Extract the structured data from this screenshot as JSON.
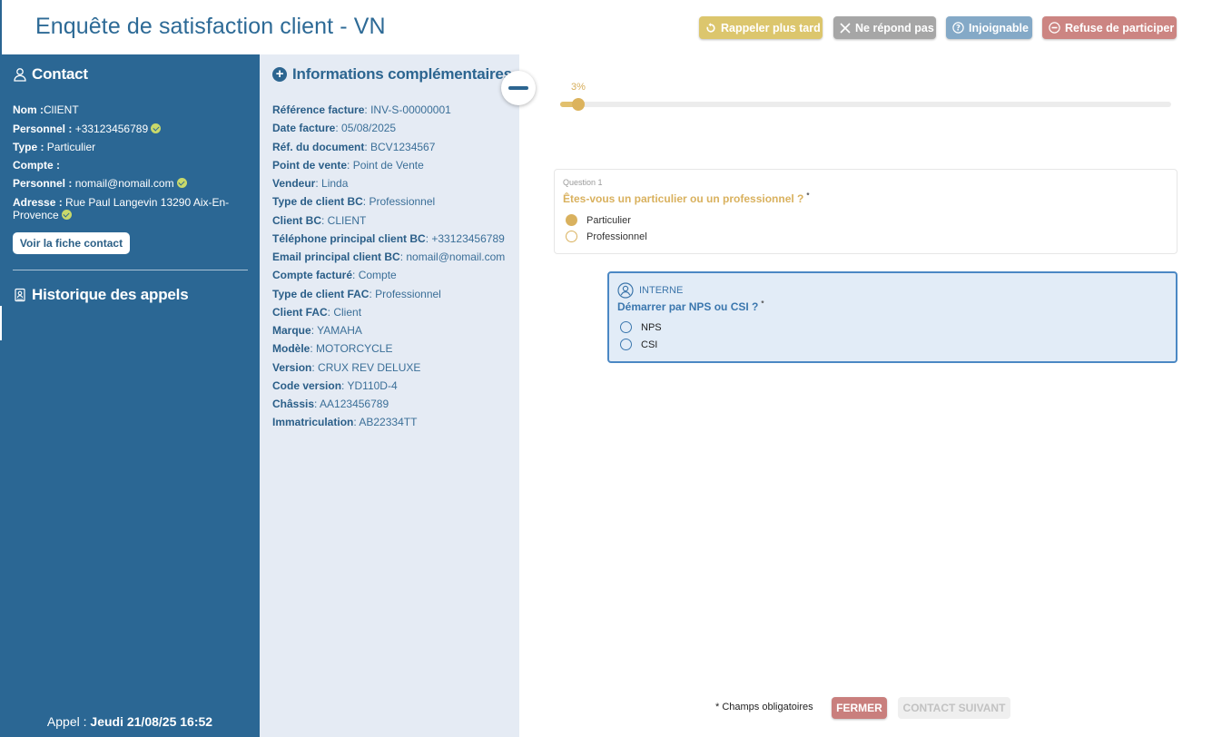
{
  "header": {
    "title": "Enquête de satisfaction client - VN",
    "buttons": [
      {
        "label": "Rappeler plus tard",
        "icon": "callback-icon",
        "color": "#dcc66d"
      },
      {
        "label": "Ne répond pas",
        "icon": "close-icon",
        "color": "#a6a6a6"
      },
      {
        "label": "Injoignable",
        "icon": "help-icon",
        "color": "#84a9c7"
      },
      {
        "label": "Refuse de participer",
        "icon": "minus-circle-icon",
        "color": "#cc8582"
      }
    ]
  },
  "contact": {
    "title": "Contact",
    "lines": [
      {
        "label": "Nom :",
        "value": "ClIENT"
      },
      {
        "label": "Personnel :",
        "value": "+33123456789"
      },
      {
        "label": "Type :",
        "value": "Particulier"
      },
      {
        "label": "Compte :",
        "value": ""
      },
      {
        "label": "Personnel :",
        "value": "nomail@nomail.com"
      },
      {
        "label": "Adresse :",
        "value": "Rue Paul Langevin 13290 Aix-En-Provence"
      }
    ],
    "view_button": "Voir la fiche contact",
    "history_title": "Historique des appels",
    "call_label": "Appel :",
    "call_value": "Jeudi 21/08/25 16:52"
  },
  "info": {
    "title": "Informations complémentaires",
    "lines": [
      {
        "label": "Référence facture",
        "value": "INV-S-00000001"
      },
      {
        "label": "Date facture",
        "value": "05/08/2025"
      },
      {
        "label": "Réf. du document",
        "value": "BCV1234567"
      },
      {
        "label": "Point de vente",
        "value": "Point de Vente"
      },
      {
        "label": "Vendeur",
        "value": "Linda"
      },
      {
        "label": "Type de client BC",
        "value": "Professionnel"
      },
      {
        "label": "Client BC",
        "value": "CLIENT"
      },
      {
        "label": "Téléphone principal client BC",
        "value": "+33123456789"
      },
      {
        "label": "Email principal client BC",
        "value": "nomail@nomail.com"
      },
      {
        "label": "Compte facturé",
        "value": "Compte"
      },
      {
        "label": "Type de client FAC",
        "value": "Professionnel"
      },
      {
        "label": "Client FAC",
        "value": "Client"
      },
      {
        "label": "Marque",
        "value": "YAMAHA"
      },
      {
        "label": "Modèle",
        "value": "MOTORCYCLE"
      },
      {
        "label": "Version",
        "value": "CRUX REV DELUXE"
      },
      {
        "label": "Code version",
        "value": "YD110D-4"
      },
      {
        "label": "Châssis",
        "value": "AA123456789"
      },
      {
        "label": "Immatriculation",
        "value": "AB22334TT"
      }
    ]
  },
  "progress": {
    "label": "3%",
    "value": 0.03
  },
  "question1": {
    "number": "Question 1",
    "text": "Êtes-vous un particulier ou un professionnel ?",
    "required_mark": "*",
    "options": [
      {
        "label": "Particulier",
        "selected": true
      },
      {
        "label": "Professionnel",
        "selected": false
      }
    ]
  },
  "internal": {
    "badge": "INTERNE",
    "text": "Démarrer par NPS ou CSI ?",
    "required_mark": "*",
    "options": [
      {
        "label": "NPS",
        "selected": false
      },
      {
        "label": "CSI",
        "selected": false
      }
    ]
  },
  "footer": {
    "required_note": "* Champs obligatoires",
    "close_label": "FERMER",
    "next_label": "CONTACT SUIVANT"
  }
}
